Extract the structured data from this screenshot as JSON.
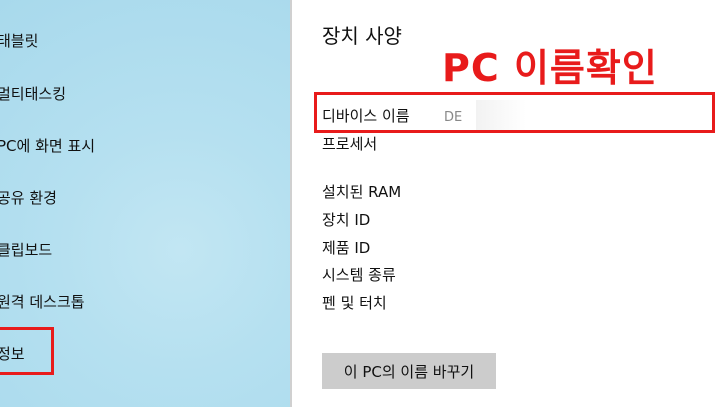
{
  "sidebar": {
    "items": [
      {
        "label": "태블릿"
      },
      {
        "label": "멀티태스킹"
      },
      {
        "label": "PC에 화면 표시"
      },
      {
        "label": "공유 환경"
      },
      {
        "label": "클립보드"
      },
      {
        "label": "원격 데스크톱"
      },
      {
        "label": "정보"
      }
    ]
  },
  "main": {
    "section_title": "장치 사양",
    "annotation": "PC 이름확인",
    "specs": {
      "device_name_label": "디바이스 이름",
      "device_name_value": "DE",
      "processor_label": "프로세서",
      "ram_label": "설치된 RAM",
      "device_id_label": "장치 ID",
      "product_id_label": "제품 ID",
      "system_type_label": "시스템 종류",
      "pen_touch_label": "펜 및 터치"
    },
    "rename_button": "이 PC의 이름 바꾸기"
  },
  "colors": {
    "highlight_red": "#e81b1b",
    "sidebar_bg": "#b5e0f0",
    "button_bg": "#cccccc"
  }
}
